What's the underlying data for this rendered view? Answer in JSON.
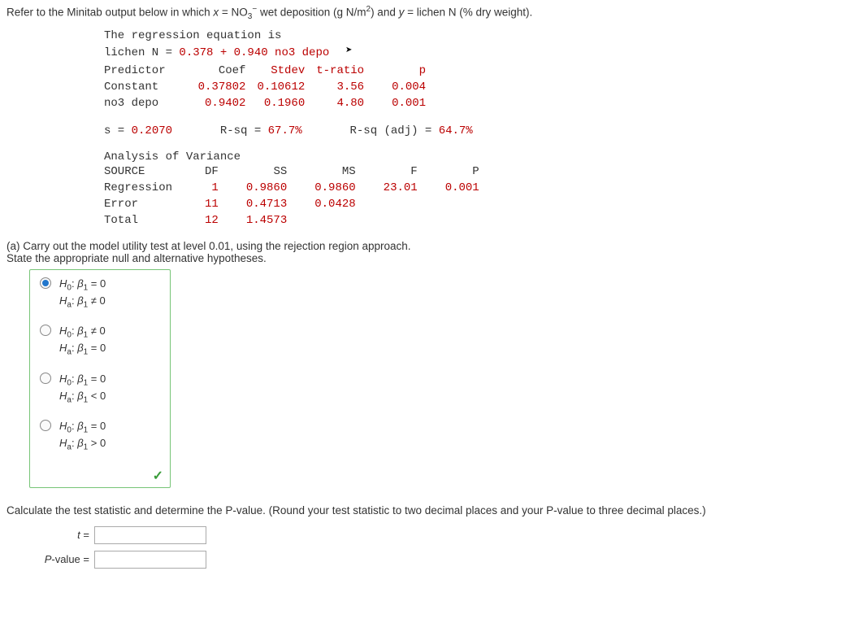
{
  "intro": {
    "prefix": "Refer to the Minitab output below in which ",
    "xvar": "x",
    "xeq": " = NO",
    "xsub": "3",
    "xsup": "−",
    "xdesc": " wet deposition (g N/m",
    "msup": "2",
    "xdesc2": ") and ",
    "yvar": "y",
    "ydesc": " = lichen N (% dry weight)."
  },
  "minitab": {
    "line1": "The regression equation is",
    "line2p1": "lichen N = ",
    "line2p2": "0.378 + 0.940 no3 depo",
    "headers": {
      "predictor": "Predictor",
      "coef": "Coef",
      "stdev": "Stdev",
      "tratio": "t-ratio",
      "p": "p"
    },
    "row1": {
      "name": "Constant",
      "coef": "0.37802",
      "stdev": "0.10612",
      "tratio": "3.56",
      "p": "0.004"
    },
    "row2": {
      "name": "no3 depo",
      "coef": "0.9402",
      "stdev": "0.1960",
      "tratio": "4.80",
      "p": "0.001"
    },
    "statline": {
      "slabel": "s = ",
      "sval": "0.2070",
      "rsqlabel": "R-sq = ",
      "rsqval": "67.7%",
      "rsqadjlabel": "R-sq (adj) = ",
      "rsqadjval": "64.7%"
    },
    "anova_title": "Analysis of Variance",
    "anova_headers": {
      "source": "SOURCE",
      "df": "DF",
      "ss": "SS",
      "ms": "MS",
      "f": "F",
      "p": "P"
    },
    "anova_row1": {
      "source": "Regression",
      "df": "1",
      "ss": "0.9860",
      "ms": "0.9860",
      "f": "23.01",
      "p": "0.001"
    },
    "anova_row2": {
      "source": "Error",
      "df": "11",
      "ss": "0.4713",
      "ms": "0.0428"
    },
    "anova_row3": {
      "source": "Total",
      "df": "12",
      "ss": "1.4573"
    }
  },
  "part_a": {
    "line1": "(a) Carry out the model utility test at level 0.01, using the rejection region approach.",
    "line2": "State the appropriate null and alternative hypotheses."
  },
  "options": {
    "o1h0p1": "H",
    "o1h0p2": "0",
    "o1h0p3": ": ",
    "o1h0p4": "β",
    "o1h0p5": "1",
    "o1h0p6": " = 0",
    "o1hap1": "H",
    "o1hap2": "a",
    "o1hap3": ": ",
    "o1hap4": "β",
    "o1hap5": "1",
    "o1hap6": " ≠ 0",
    "o2h0p1": "H",
    "o2h0p2": "0",
    "o2h0p3": ": ",
    "o2h0p4": "β",
    "o2h0p5": "1",
    "o2h0p6": " ≠ 0",
    "o2hap1": "H",
    "o2hap2": "a",
    "o2hap3": ": ",
    "o2hap4": "β",
    "o2hap5": "1",
    "o2hap6": " = 0",
    "o3h0p1": "H",
    "o3h0p2": "0",
    "o3h0p3": ": ",
    "o3h0p4": "β",
    "o3h0p5": "1",
    "o3h0p6": " = 0",
    "o3hap1": "H",
    "o3hap2": "a",
    "o3hap3": ": ",
    "o3hap4": "β",
    "o3hap5": "1",
    "o3hap6": " < 0",
    "o4h0p1": "H",
    "o4h0p2": "0",
    "o4h0p3": ": ",
    "o4h0p4": "β",
    "o4h0p5": "1",
    "o4h0p6": " = 0",
    "o4hap1": "H",
    "o4hap2": "a",
    "o4hap3": ": ",
    "o4hap4": "β",
    "o4hap5": "1",
    "o4hap6": " > 0"
  },
  "calc": {
    "prompt": "Calculate the test statistic and determine the P-value. (Round your test statistic to two decimal places and your P-value to three decimal places.)",
    "tlabel_var": "t",
    "tlabel_eq": " = ",
    "pvlabel_var": "P",
    "pvlabel_rest": "-value = "
  }
}
